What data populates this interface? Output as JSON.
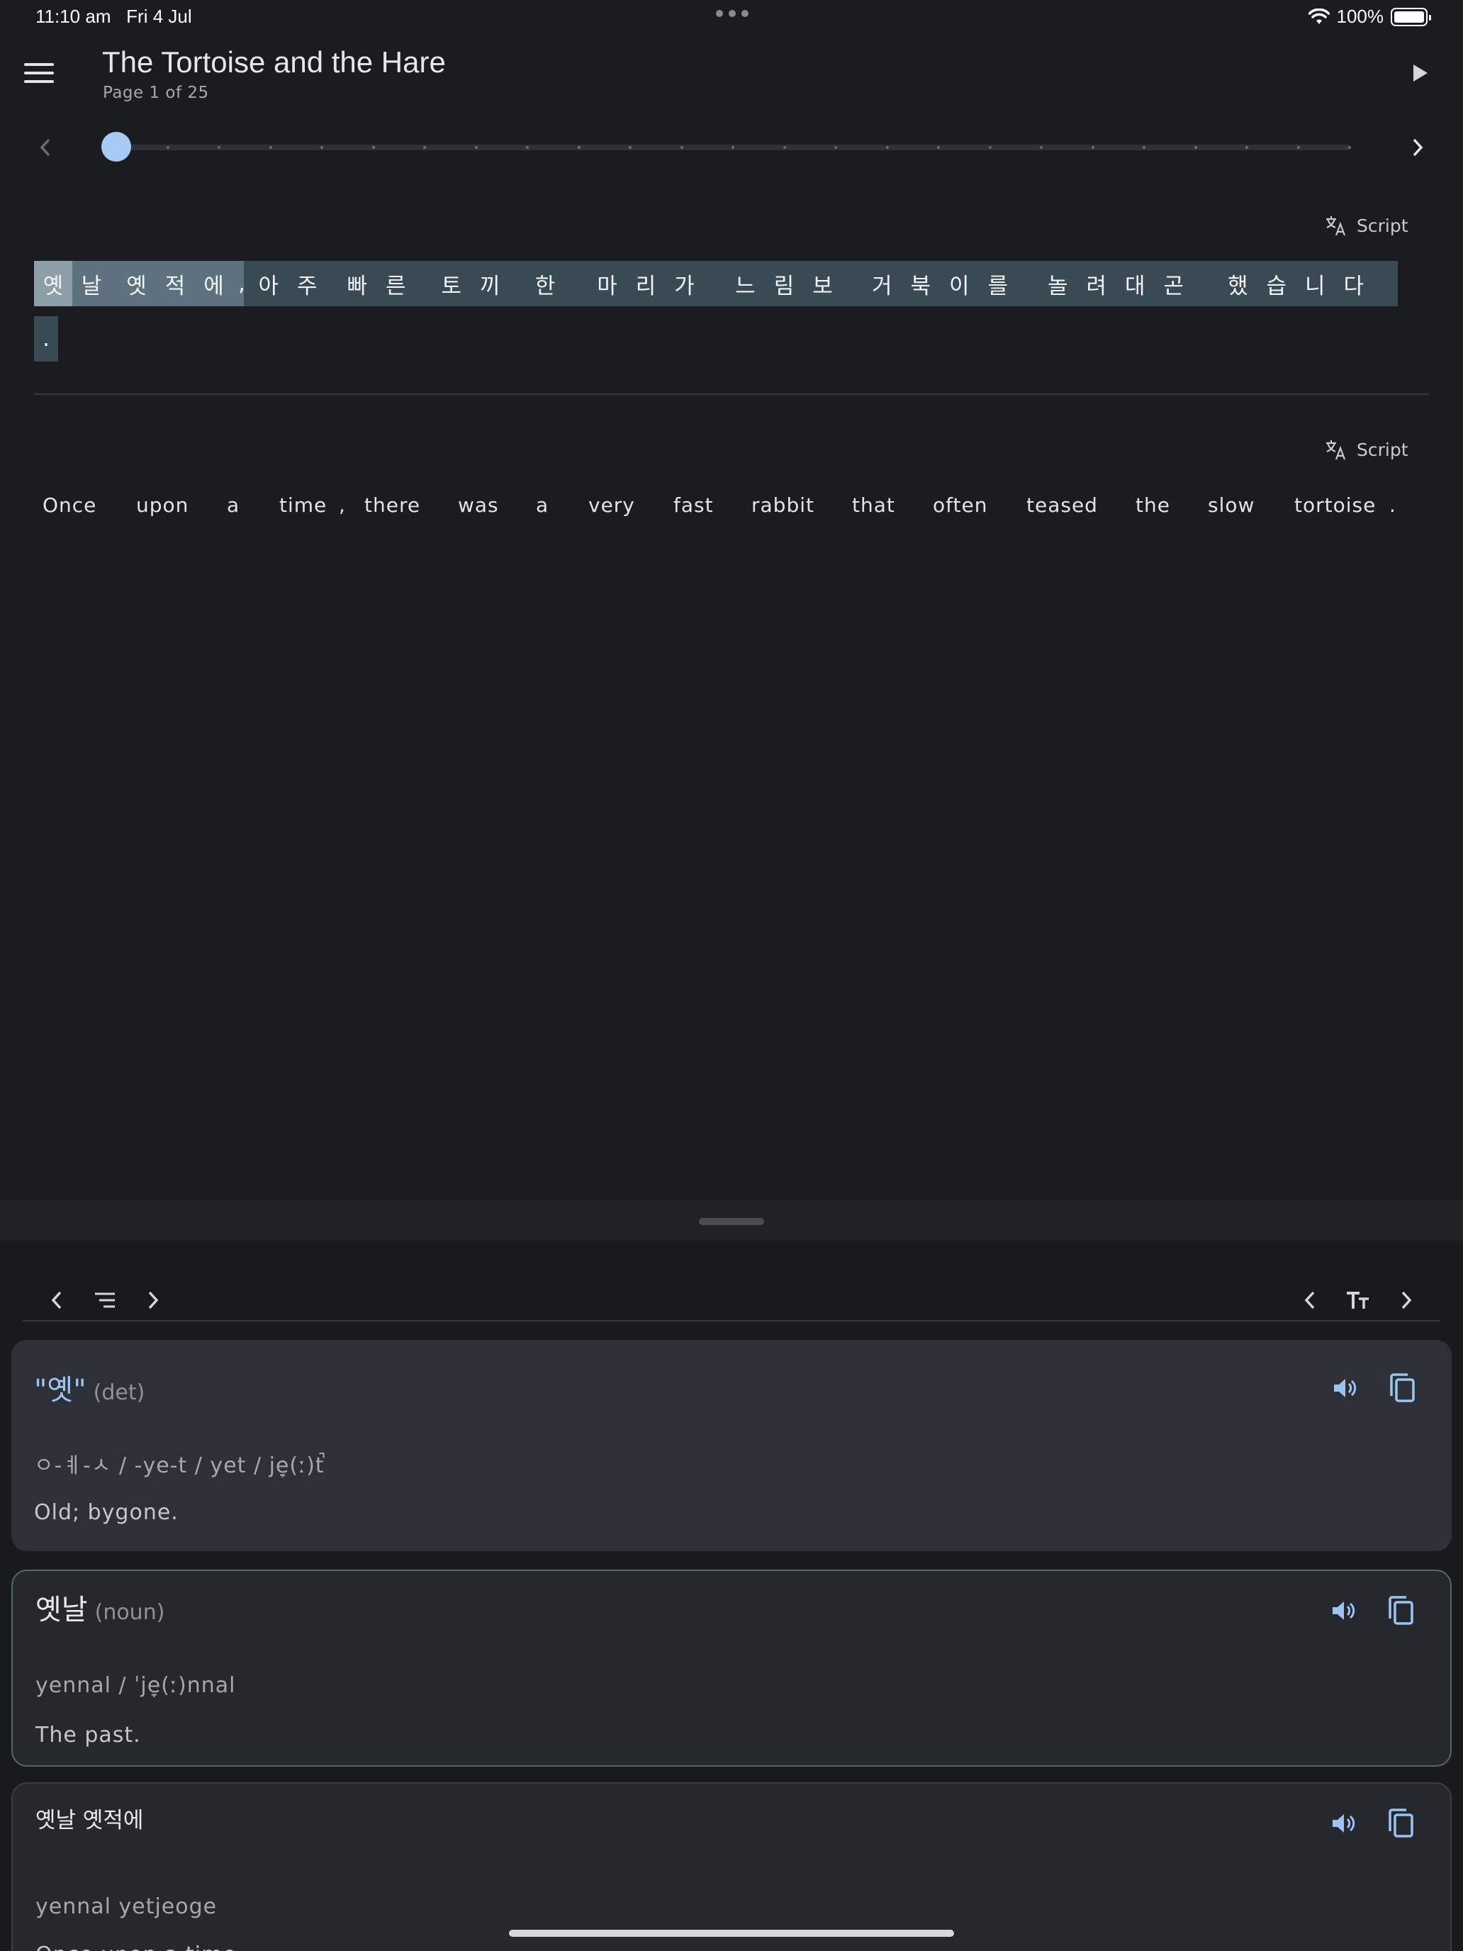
{
  "status_bar": {
    "time": "11:10 am",
    "date": "Fri 4 Jul",
    "battery": "100%"
  },
  "app_bar": {
    "title": "The Tortoise and the Hare",
    "subtitle": "Page 1 of 25",
    "play_icon": "play-icon",
    "menu_icon": "menu-icon"
  },
  "page_slider": {
    "current_page": 1,
    "total_pages": 25
  },
  "script_toggle": {
    "label": "Script",
    "icon": "translate-icon"
  },
  "korean_sentence": [
    {
      "text": "옛날"
    },
    {
      "text": "옛적에"
    },
    {
      "text": ","
    },
    {
      "text": "아주"
    },
    {
      "text": "빠른"
    },
    {
      "text": "토끼"
    },
    {
      "text": "한"
    },
    {
      "text": "마리가"
    },
    {
      "text": "느림보"
    },
    {
      "text": "거북이를"
    },
    {
      "text": "놀려대곤"
    },
    {
      "text": "했습니다"
    },
    {
      "text": "."
    }
  ],
  "english_sentence": [
    "Once",
    "upon",
    "a",
    "time",
    ",",
    "there",
    "was",
    "a",
    "very",
    "fast",
    "rabbit",
    "that",
    "often",
    "teased",
    "the",
    "slow",
    "tortoise",
    "."
  ],
  "sheet_toolbar": {
    "left_icons": [
      "chevron-left-icon",
      "list-icon",
      "chevron-right-icon"
    ],
    "right_icons": [
      "chevron-left-icon",
      "text-size-icon",
      "chevron-right-icon"
    ]
  },
  "cards": [
    {
      "word": "\"옛\"",
      "pos": "(det)",
      "pron": "ㅇ-ㅖ-ㅅ / -ye-t / yet / je̞(ː)t̚",
      "def": "Old; bygone."
    },
    {
      "word": "옛날",
      "pos": "(noun)",
      "pron": "yennal / ˈje̞(ː)nnal",
      "def": "The past."
    },
    {
      "word": "옛날 옛적에",
      "pos": "",
      "pron": "yennal yetjeoge",
      "def": "Once upon a time."
    }
  ],
  "colors": {
    "accent": "#9cc4f2",
    "slider_thumb": "#a7cbf5",
    "background": "#1b1c20"
  }
}
